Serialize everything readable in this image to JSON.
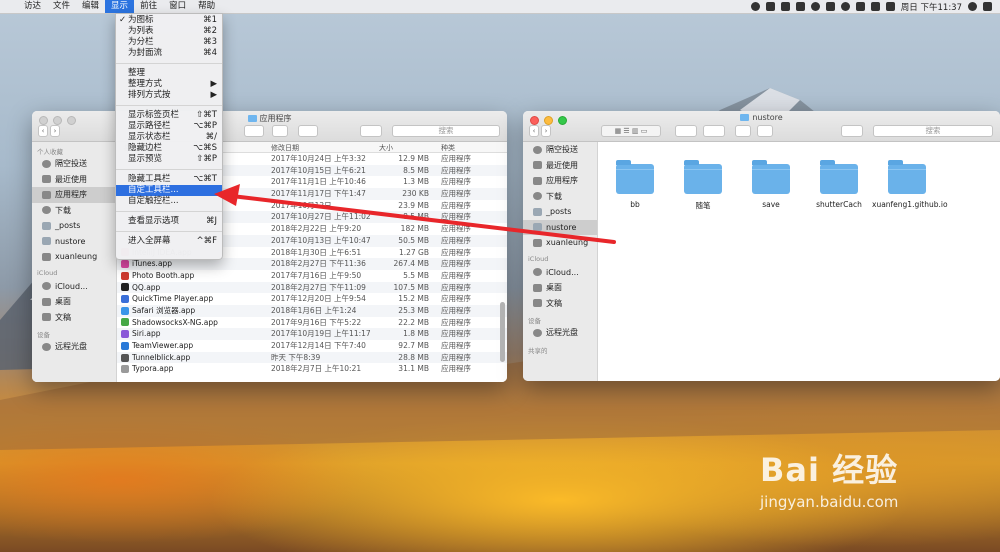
{
  "menubar": {
    "items": [
      "访达",
      "文件",
      "编辑",
      "显示",
      "前往",
      "窗口",
      "帮助"
    ],
    "active": "显示",
    "clock": "周日 下午11:37"
  },
  "view_menu": {
    "items": [
      {
        "label": "为图标",
        "shortcut": "⌘1",
        "checked": true
      },
      {
        "label": "为列表",
        "shortcut": "⌘2"
      },
      {
        "label": "为分栏",
        "shortcut": "⌘3"
      },
      {
        "label": "为封面流",
        "shortcut": "⌘4"
      },
      {
        "sep": true
      },
      {
        "label": "整理",
        "shortcut": ""
      },
      {
        "label": "整理方式",
        "shortcut": "▶"
      },
      {
        "label": "排列方式按",
        "shortcut": "▶"
      },
      {
        "sep": true
      },
      {
        "label": "显示标签页栏",
        "shortcut": "⇧⌘T"
      },
      {
        "label": "显示路径栏",
        "shortcut": "⌥⌘P"
      },
      {
        "label": "显示状态栏",
        "shortcut": "⌘/"
      },
      {
        "label": "隐藏边栏",
        "shortcut": "⌥⌘S"
      },
      {
        "label": "显示预览",
        "shortcut": "⇧⌘P"
      },
      {
        "sep": true
      },
      {
        "label": "隐藏工具栏",
        "shortcut": "⌥⌘T"
      },
      {
        "label": "自定工具栏...",
        "shortcut": "",
        "highlighted": true
      },
      {
        "label": "自定触控栏...",
        "shortcut": ""
      },
      {
        "sep": true
      },
      {
        "label": "查看显示选项",
        "shortcut": "⌘J"
      },
      {
        "sep": true
      },
      {
        "label": "进入全屏幕",
        "shortcut": "^⌘F"
      }
    ]
  },
  "left_window": {
    "title": "应用程序",
    "search_placeholder": "搜索",
    "sidebar": {
      "favorites_header": "个人收藏",
      "favorites": [
        "隔空投送",
        "最近使用",
        "应用程序",
        "下载",
        "_posts",
        "nustore",
        "xuanleung"
      ],
      "selected": "应用程序",
      "icloud_header": "iCloud",
      "icloud": [
        "iCloud...",
        "桌面",
        "文稿"
      ],
      "devices_header": "设备",
      "devices": [
        "远程光盘"
      ]
    },
    "columns": {
      "name": "名称",
      "date": "修改日期",
      "size": "大小",
      "kind": "种类"
    },
    "rows": [
      {
        "name": "",
        "date": "2017年10月24日 上午3:32",
        "size": "12.9 MB",
        "kind": "应用程序"
      },
      {
        "name": "",
        "date": "2017年10月15日 上午6:21",
        "size": "8.5 MB",
        "kind": "应用程序"
      },
      {
        "name": "",
        "date": "2017年11月1日 上午10:46",
        "size": "1.3 MB",
        "kind": "应用程序"
      },
      {
        "name": "",
        "date": "2017年11月17日 下午1:47",
        "size": "230 KB",
        "kind": "应用程序"
      },
      {
        "name": "",
        "date": "2017年10月12日 ...",
        "size": "23.9 MB",
        "kind": "应用程序"
      },
      {
        "name": "",
        "date": "2017年10月27日 上午11:02",
        "size": "8.5 MB",
        "kind": "应用程序"
      },
      {
        "name": "",
        "date": "2018年2月22日 上午9:20",
        "size": "182 MB",
        "kind": "应用程序"
      },
      {
        "name": "",
        "date": "2017年10月13日 上午10:47",
        "size": "50.5 MB",
        "kind": "应用程序"
      },
      {
        "name": "IntelliJ IDEA.app",
        "date": "2018年1月30日 上午6:51",
        "size": "1.27 GB",
        "kind": "应用程序"
      },
      {
        "name": "iTunes.app",
        "date": "2018年2月27日 下午11:36",
        "size": "267.4 MB",
        "kind": "应用程序"
      },
      {
        "name": "Photo Booth.app",
        "date": "2017年7月16日 上午9:50",
        "size": "5.5 MB",
        "kind": "应用程序"
      },
      {
        "name": "QQ.app",
        "date": "2018年2月27日 下午11:09",
        "size": "107.5 MB",
        "kind": "应用程序"
      },
      {
        "name": "QuickTime Player.app",
        "date": "2017年12月20日 上午9:54",
        "size": "15.2 MB",
        "kind": "应用程序"
      },
      {
        "name": "Safari 浏览器.app",
        "date": "2018年1月6日 上午1:24",
        "size": "25.3 MB",
        "kind": "应用程序"
      },
      {
        "name": "ShadowsocksX-NG.app",
        "date": "2017年9月16日 下午5:22",
        "size": "22.2 MB",
        "kind": "应用程序"
      },
      {
        "name": "Siri.app",
        "date": "2017年10月19日 上午11:17",
        "size": "1.8 MB",
        "kind": "应用程序"
      },
      {
        "name": "TeamViewer.app",
        "date": "2017年12月14日 下午7:40",
        "size": "92.7 MB",
        "kind": "应用程序"
      },
      {
        "name": "Tunnelblick.app",
        "date": "昨天 下午8:39",
        "size": "28.8 MB",
        "kind": "应用程序"
      },
      {
        "name": "Typora.app",
        "date": "2018年2月7日 上午10:21",
        "size": "31.1 MB",
        "kind": "应用程序"
      }
    ],
    "row_icon_colors": [
      "#3a3a3a",
      "#3a3a3a",
      "#3a3a3a",
      "#3a3a3a",
      "#3a3a3a",
      "#3a3a3a",
      "#3a3a3a",
      "#3a3a3a",
      "#d93b5f",
      "#e04aa7",
      "#cf3a2f",
      "#222222",
      "#3a6fd8",
      "#3a95e8",
      "#46a846",
      "#8a59d8",
      "#2a7ad8",
      "#555555",
      "#9a9a9a"
    ]
  },
  "right_window": {
    "title": "nustore",
    "search_placeholder": "搜索",
    "sidebar": {
      "favorites": [
        "隔空投送",
        "最近使用",
        "应用程序",
        "下载",
        "_posts",
        "nustore",
        "xuanleung"
      ],
      "selected": "nustore",
      "icloud_header": "iCloud",
      "icloud": [
        "iCloud...",
        "桌面",
        "文稿"
      ],
      "devices_header": "设备",
      "devices": [
        "远程光盘"
      ],
      "shared_header": "共享的"
    },
    "folders": [
      "bb",
      "随笔",
      "save",
      "shutterCach",
      "xuanfeng1.github.io"
    ]
  },
  "watermark": {
    "brand": "Bai 经验",
    "url": "jingyan.baidu.com"
  },
  "colors": {
    "accent": "#2c74e0",
    "folder": "#6ab2ea",
    "arrow": "#e8262a"
  }
}
